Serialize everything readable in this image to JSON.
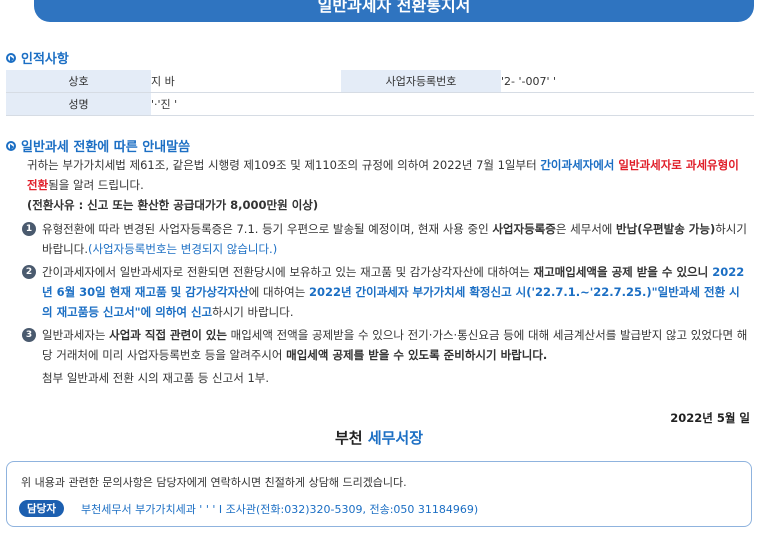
{
  "banner_title": "일반과세자 전환통지서",
  "section1": {
    "title": "인적사항",
    "rows": [
      {
        "label1": "상호",
        "value1": "지    바",
        "label2": "사업자등록번호",
        "value2": "'2-  '-007'  '"
      },
      {
        "label1": "성명",
        "value1": "'·'진  '"
      }
    ]
  },
  "section2": {
    "title": "일반과세 전환에 따른 안내말씀",
    "intro_a": "귀하는 부가가치세법 제61조, 같은법 시행령 제109조 및 제110조의 규정에 의하여 2022년 7월 1일부터 ",
    "intro_b": "간이과세자에서",
    "intro_c": " 일반과세자로 과세유형이 전환",
    "intro_d": "됨을 알려 드립니다.",
    "reason": "(전환사유 : 신고 또는 환산한 공급대가가 8,000만원 이상)",
    "items": [
      {
        "num": "1",
        "t1": "유형전환에 따라 변경된 사업자등록증은 7.1. 등기 우편으로 발송될 예정이며, 현재 사용 중인 ",
        "t2": "사업자등록증",
        "t3": "은 세무서에 ",
        "t4": "반납(우편발송 가능)",
        "t5": "하시기 바랍니다.",
        "t6": "(사업자등록번호는 변경되지 않습니다.)"
      },
      {
        "num": "2",
        "t1": "간이과세자에서 일반과세자로 전환되면 전환당시에 보유하고 있는 재고품 및 감가상각자산에 대하여는 ",
        "t2": "재고매입세액을 공제 받을 수 있으니",
        "t3": " 2022년 6월 30일 현재 재고품 및 감가상각자산",
        "t4": "에 대하여는 ",
        "t5": "2022년 간이과세자 부가가치세 확정신고 시('22.7.1.~'22.7.25.)",
        "t6": "\"일반과세 전환 시의 재고품등 신고서\"에 의하여 신고",
        "t7": "하시기 바랍니다."
      },
      {
        "num": "3",
        "t1": "일반과세자는 ",
        "t2": "사업과 직접 관련이 있는",
        "t3": " 매입세액 전액을 공제받을 수 있으나 전기·가스·통신요금 등에 대해 세금계산서를 발급받지 않고 있었다면 해당 거래처에 미리 사업자등록번호 등을 알려주시어 ",
        "t4": "매입세액 공제를 받을 수 있도록 준비하시기 바랍니다."
      }
    ],
    "attachment": "첨부 일반과세 전환 시의 재고품 등 신고서 1부."
  },
  "date": "2022년 5월 일",
  "office": {
    "part1": "부천",
    "part2": "세무서장"
  },
  "contact": {
    "message": "위 내용과 관련한 문의사항은 담당자에게 연락하시면 친절하게 상담해 드리겠습니다.",
    "badge": "담당자",
    "info": "부천세무서 부가가치세과 '  ' ' I 조사관(전화:032)320-5309, 전송:050 31184969)"
  }
}
